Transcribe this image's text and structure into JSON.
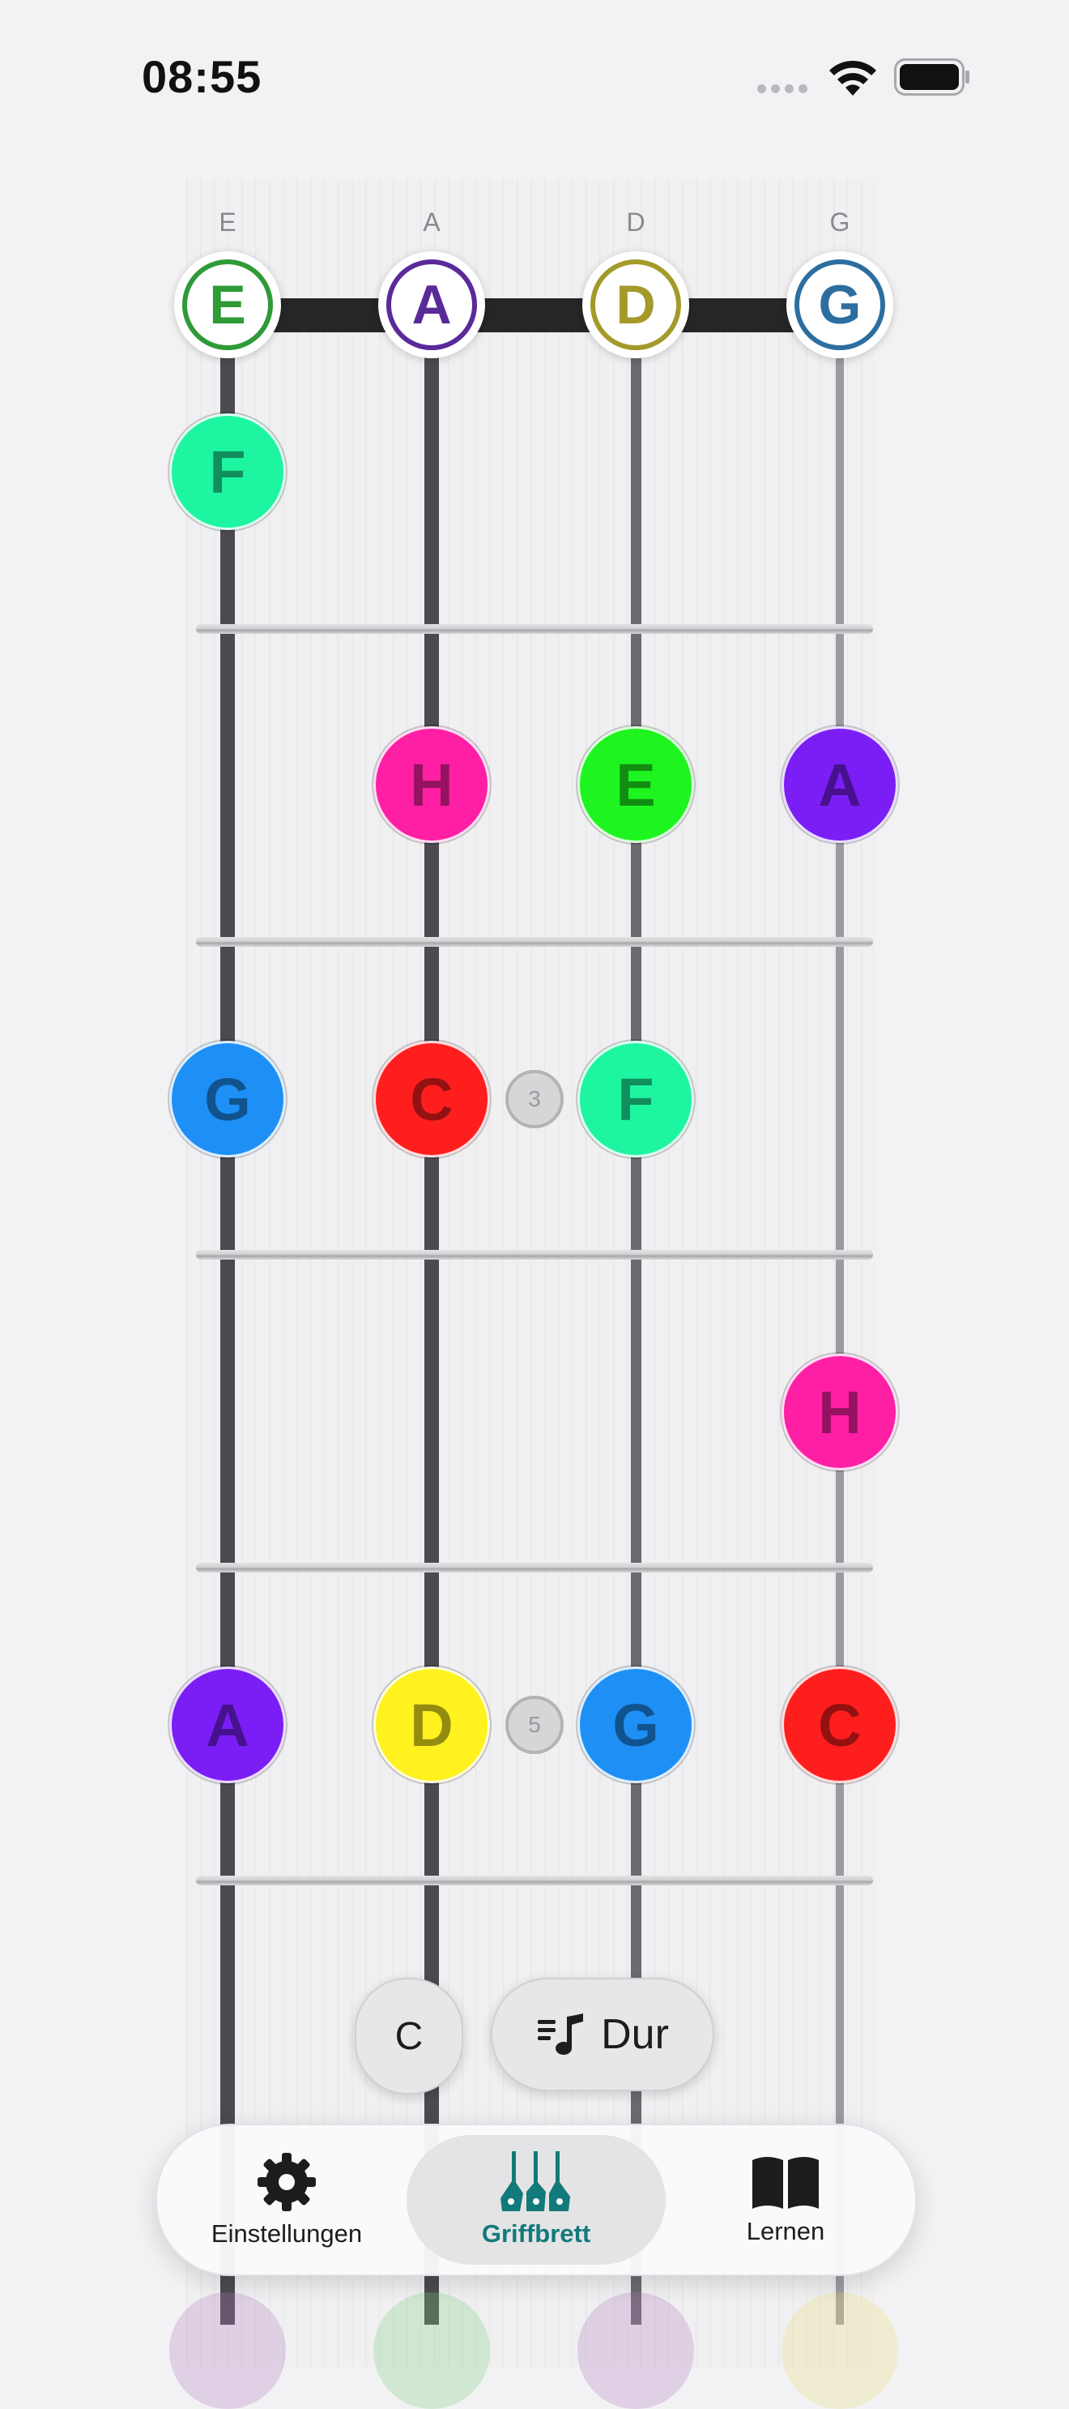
{
  "status_bar": {
    "time": "08:55"
  },
  "fretboard": {
    "string_labels": [
      "E",
      "A",
      "D",
      "G"
    ],
    "open_strings": [
      {
        "note": "E",
        "color": "#2e9a38"
      },
      {
        "note": "A",
        "color": "#5a2a9a"
      },
      {
        "note": "D",
        "color": "#a39a2a"
      },
      {
        "note": "G",
        "color": "#2d6ea0"
      }
    ],
    "notes": [
      {
        "note": "F",
        "string": 0,
        "fret": 1,
        "color": "#1ef5a0"
      },
      {
        "note": "H",
        "string": 1,
        "fret": 2,
        "color": "#ff1fa5"
      },
      {
        "note": "E",
        "string": 2,
        "fret": 2,
        "color": "#1ef520"
      },
      {
        "note": "A",
        "string": 3,
        "fret": 2,
        "color": "#7a1ef5"
      },
      {
        "note": "G",
        "string": 0,
        "fret": 3,
        "color": "#1e90f5"
      },
      {
        "note": "C",
        "string": 1,
        "fret": 3,
        "color": "#ff1e1e"
      },
      {
        "note": "F",
        "string": 2,
        "fret": 3,
        "color": "#1ef5a0"
      },
      {
        "note": "H",
        "string": 3,
        "fret": 4,
        "color": "#ff1fa5"
      },
      {
        "note": "A",
        "string": 0,
        "fret": 5,
        "color": "#7a1ef5"
      },
      {
        "note": "D",
        "string": 1,
        "fret": 5,
        "color": "#fff21e"
      },
      {
        "note": "G",
        "string": 2,
        "fret": 5,
        "color": "#1e90f5"
      },
      {
        "note": "C",
        "string": 3,
        "fret": 5,
        "color": "#ff1e1e"
      }
    ],
    "fret_markers": [
      {
        "label": "3",
        "fret": 3
      },
      {
        "label": "5",
        "fret": 5
      }
    ]
  },
  "controls": {
    "key_label": "C",
    "scale_label": "Dur"
  },
  "tab_bar": {
    "tabs": [
      {
        "label": "Einstellungen",
        "icon": "gear-icon"
      },
      {
        "label": "Griffbrett",
        "icon": "guitars-icon"
      },
      {
        "label": "Lernen",
        "icon": "book-icon"
      }
    ],
    "active_color": "#127a7a"
  }
}
